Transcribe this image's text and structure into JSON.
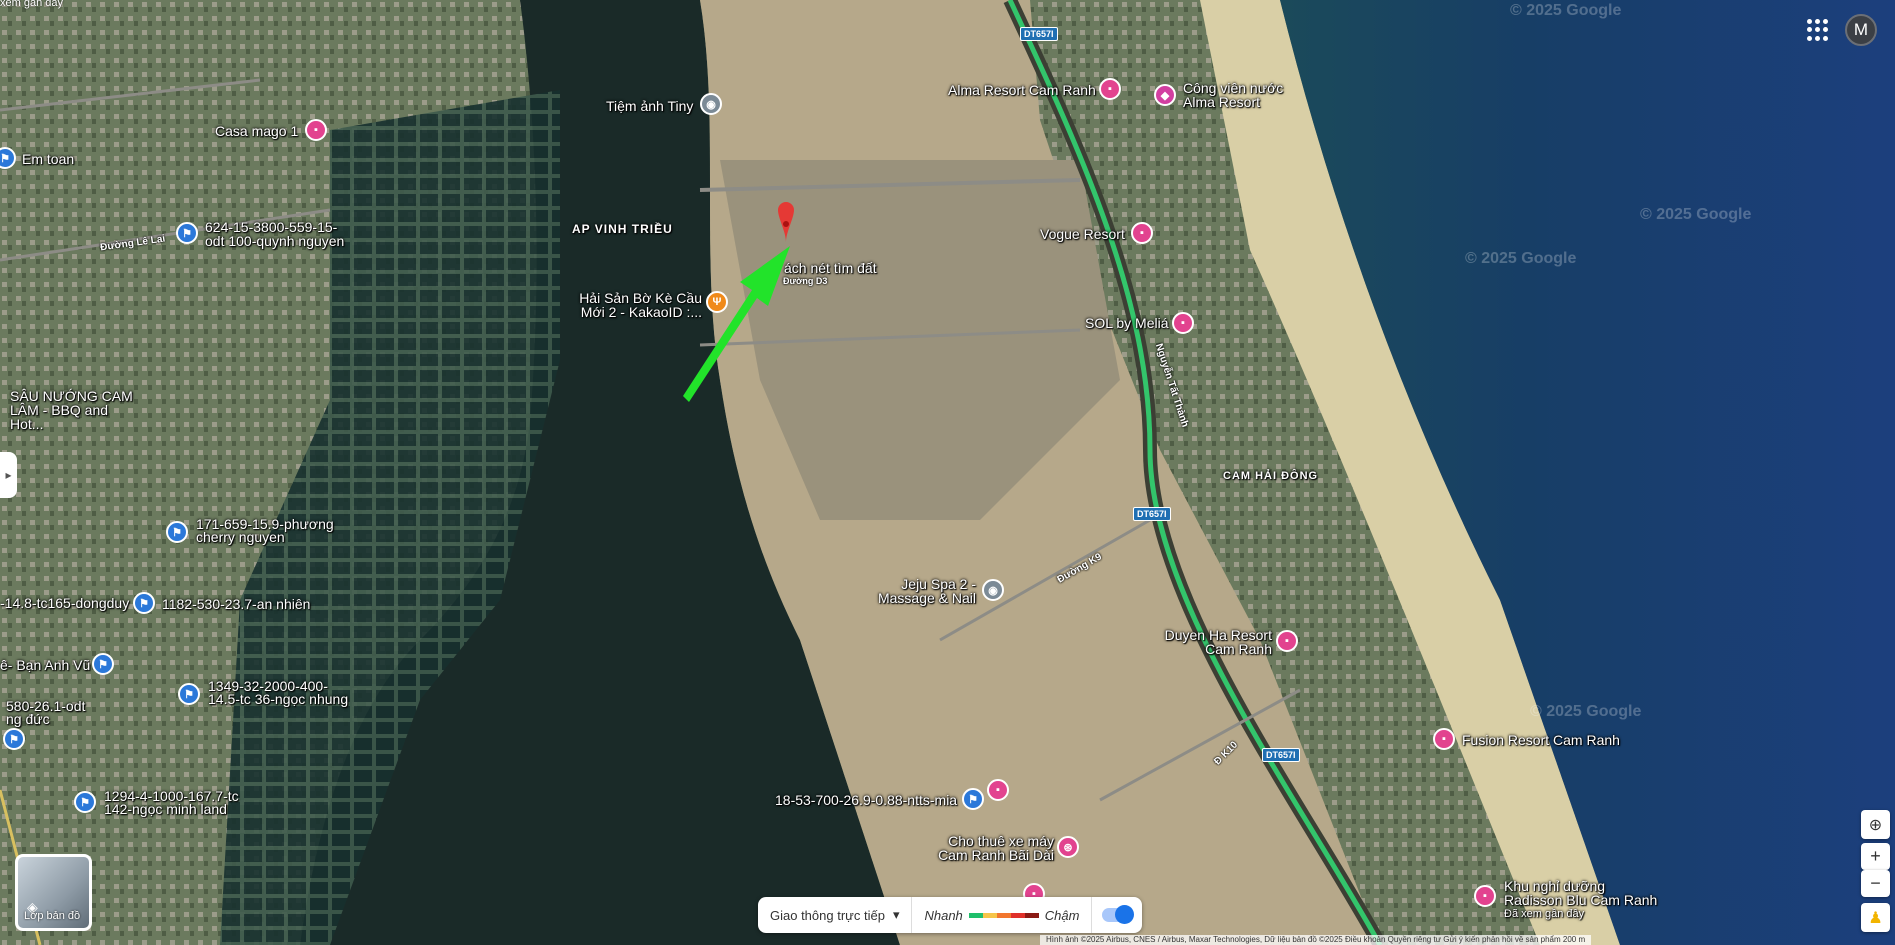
{
  "map": {
    "top_left_text": "xem gần đây",
    "area_labels": [
      {
        "text": "AP VINH TRIỀU"
      },
      {
        "text": "CAM HẢI ĐÔNG"
      }
    ],
    "road_labels": [
      "Đường Lê Lai",
      "Nguyễn Tất Thành",
      "Đường K9",
      "Đ K10",
      "Đường D3"
    ],
    "shields": [
      "DT657I",
      "DT657I",
      "DT657I"
    ],
    "places": [
      {
        "name": "Tiệm ảnh Tiny",
        "icon": "camera-icon"
      },
      {
        "name": "Casa mago 1",
        "icon": "hotel-icon"
      },
      {
        "name": "Em toan",
        "icon": "flag-icon"
      },
      {
        "name": "624-15-3800-559-15-odt 100-quynh nguyen",
        "icon": "flag-icon"
      },
      {
        "name": "Hải Sản Bờ Kè Cầu Mới 2 - KakaoID :...",
        "icon": "restaurant-icon"
      },
      {
        "name": "SÂU NƯỚNG CAM LÂM - BBQ and Hot...",
        "icon": "restaurant-icon"
      },
      {
        "name": "171-659-15.9-phương cherry nguyen",
        "icon": "flag-icon"
      },
      {
        "name": "-14.8-tc165-dongduy",
        "icon": "flag-icon"
      },
      {
        "name": "1182-530-23.7-an nhiên",
        "icon": "flag-icon"
      },
      {
        "name": "ê- Bạn Anh Vũ",
        "icon": "flag-icon"
      },
      {
        "name": "1349-32-2000-400-14.5-tc 36-ngọc nhung",
        "icon": "flag-icon"
      },
      {
        "name": "580-26.1-odt ng đức",
        "icon": "flag-icon"
      },
      {
        "name": "1294-4-1000-167.7-tc 142-ngọc minh land",
        "icon": "flag-icon"
      },
      {
        "name": "Alma Resort Cam Ranh",
        "icon": "hotel-icon"
      },
      {
        "name": "Công viên nước Alma Resort",
        "icon": "park-icon"
      },
      {
        "name": "Vogue Resort",
        "icon": "hotel-icon"
      },
      {
        "name": "SOL by Meliá",
        "icon": "hotel-icon"
      },
      {
        "name": "ách nét tìm đất",
        "icon": "pin-icon"
      },
      {
        "name": "Jeju Spa 2 - Massage & Nail",
        "icon": "spa-icon"
      },
      {
        "name": "Duyen Ha Resort Cam Ranh",
        "icon": "hotel-icon"
      },
      {
        "name": "Fusion Resort Cam Ranh",
        "icon": "hotel-icon"
      },
      {
        "name": "18-53-700-26.9-0.88-ntts-mia",
        "icon": "flag-icon"
      },
      {
        "name": "Cho thuê xe máy Cam Ranh Bãi Dài",
        "icon": "motorbike-icon"
      },
      {
        "name": "Khu nghỉ dưỡng Radisson Blu Cam Ranh",
        "icon": "hotel-icon"
      },
      {
        "name": "Đã xem gần đây",
        "icon": ""
      }
    ],
    "watermark": "© 2025 Google"
  },
  "header": {
    "avatar_letter": "M"
  },
  "layers": {
    "label": "Lớp bản đồ"
  },
  "traffic": {
    "mode_label": "Giao thông trực tiếp",
    "fast_label": "Nhanh",
    "slow_label": "Chậm",
    "colors": [
      "#1fbf6b",
      "#f6c54a",
      "#f2762e",
      "#e0312a",
      "#8b1a14"
    ]
  },
  "controls": {
    "zoom_in": "+",
    "zoom_out": "−"
  },
  "attribution": {
    "text": "Hình ảnh ©2025 Airbus, CNES / Airbus, Maxar Technologies, Dữ liệu bản đồ ©2025   Điều khoản   Quyền riêng tư   Gửi ý kiến phản hồi về sản phẩm   200 m"
  },
  "annotation": {
    "arrow_color": "#22e32a",
    "marker_color": "#e53935"
  }
}
